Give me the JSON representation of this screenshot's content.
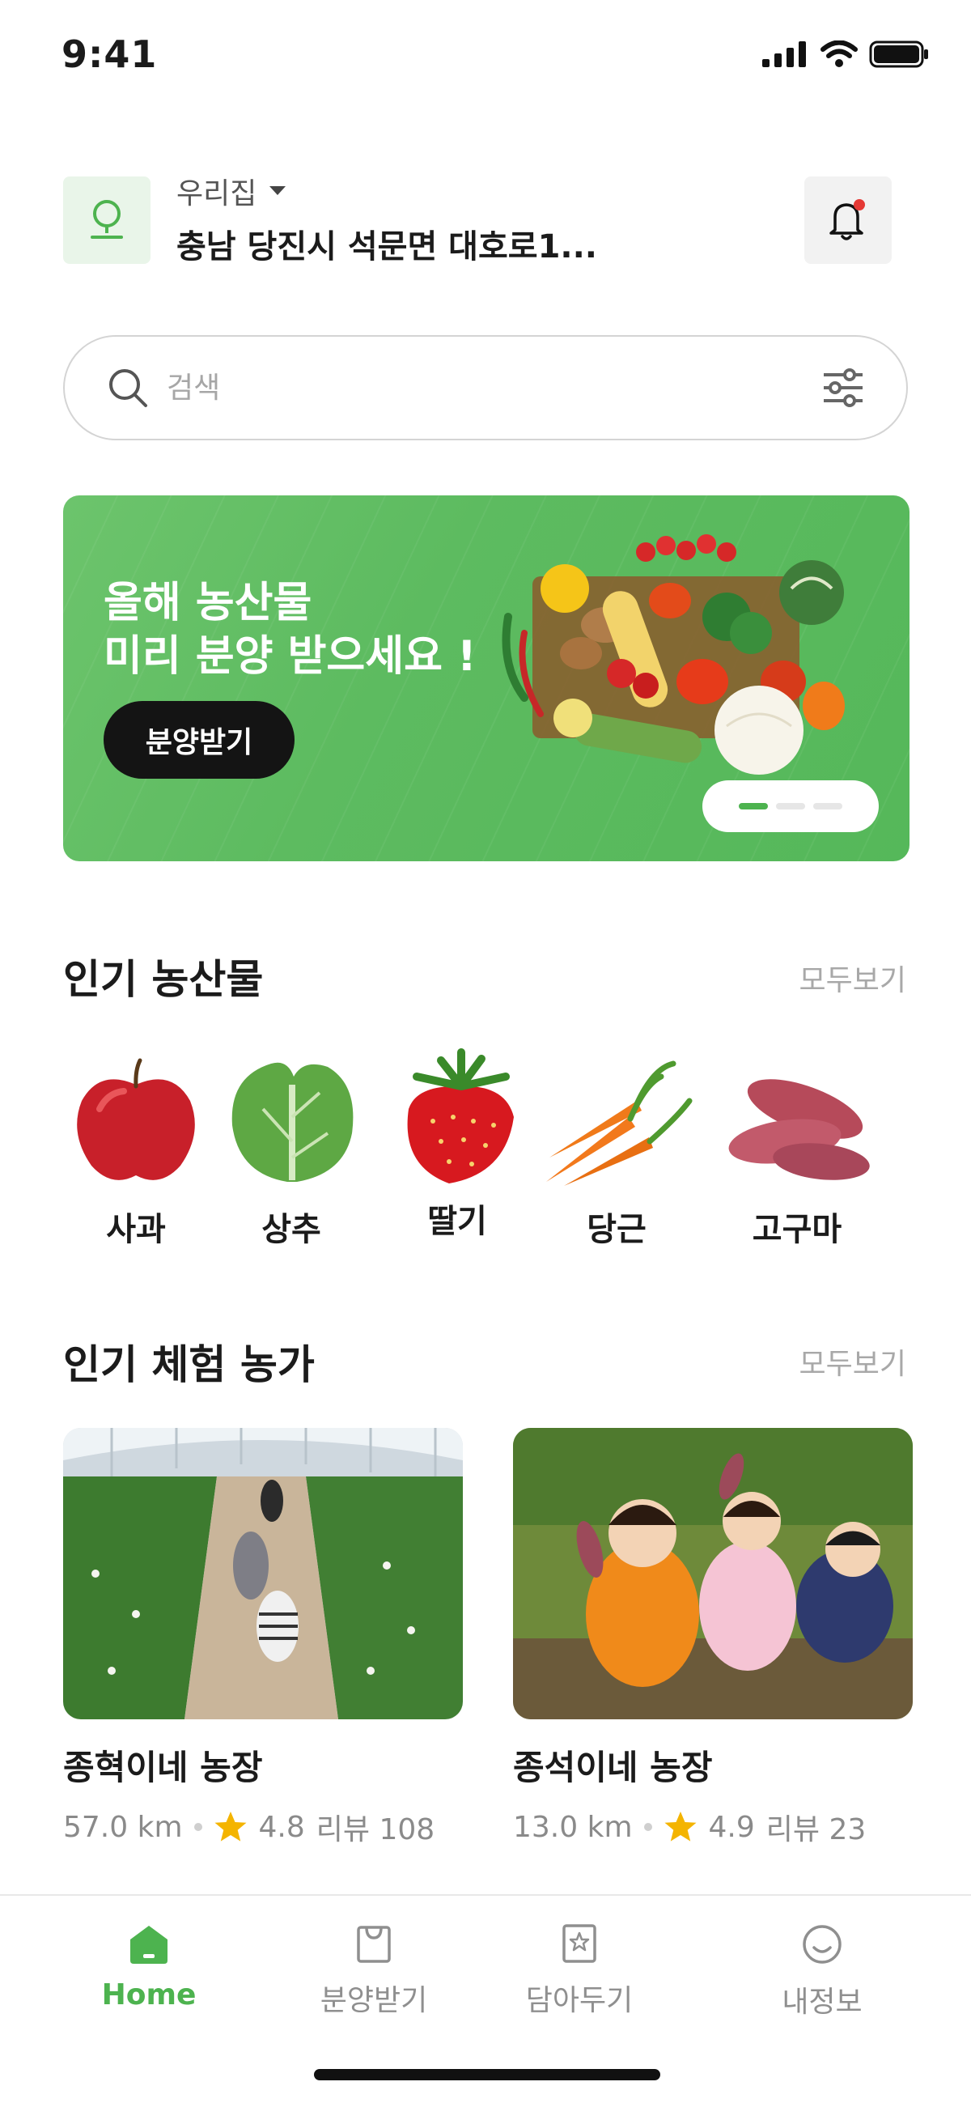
{
  "status_bar": {
    "time": "9:41"
  },
  "header": {
    "location_label": "우리집",
    "address": "충남 당진시 석문면 대호로1..."
  },
  "search": {
    "placeholder": "검색"
  },
  "banner": {
    "title": "올해 농산물\n미리 분양 받으세요 !",
    "button_label": "분양받기",
    "pages": 3,
    "active_page": 1
  },
  "popular_produce": {
    "title": "인기 농산물",
    "see_all": "모두보기",
    "items": [
      {
        "label": "사과",
        "icon": "apple"
      },
      {
        "label": "상추",
        "icon": "lettuce"
      },
      {
        "label": "딸기",
        "icon": "strawberry"
      },
      {
        "label": "당근",
        "icon": "carrot"
      },
      {
        "label": "고구마",
        "icon": "sweet-potato"
      }
    ]
  },
  "popular_farms": {
    "title": "인기 체험 농가",
    "see_all": "모두보기",
    "items": [
      {
        "name": "종혁이네 농장",
        "distance": "57.0 km",
        "rating": "4.8",
        "reviews": "리뷰 108"
      },
      {
        "name": "종석이네 농장",
        "distance": "13.0 km",
        "rating": "4.9",
        "reviews": "리뷰 23"
      }
    ]
  },
  "bottom_nav": {
    "items": [
      {
        "label": "Home",
        "icon": "home-icon",
        "active": true
      },
      {
        "label": "분양받기",
        "icon": "bag-icon",
        "active": false
      },
      {
        "label": "담아두기",
        "icon": "bookmark-icon",
        "active": false
      },
      {
        "label": "내정보",
        "icon": "smile-icon",
        "active": false
      }
    ]
  },
  "colors": {
    "accent": "#4db34f",
    "banner": "#5dbb60",
    "star": "#f4b400"
  }
}
